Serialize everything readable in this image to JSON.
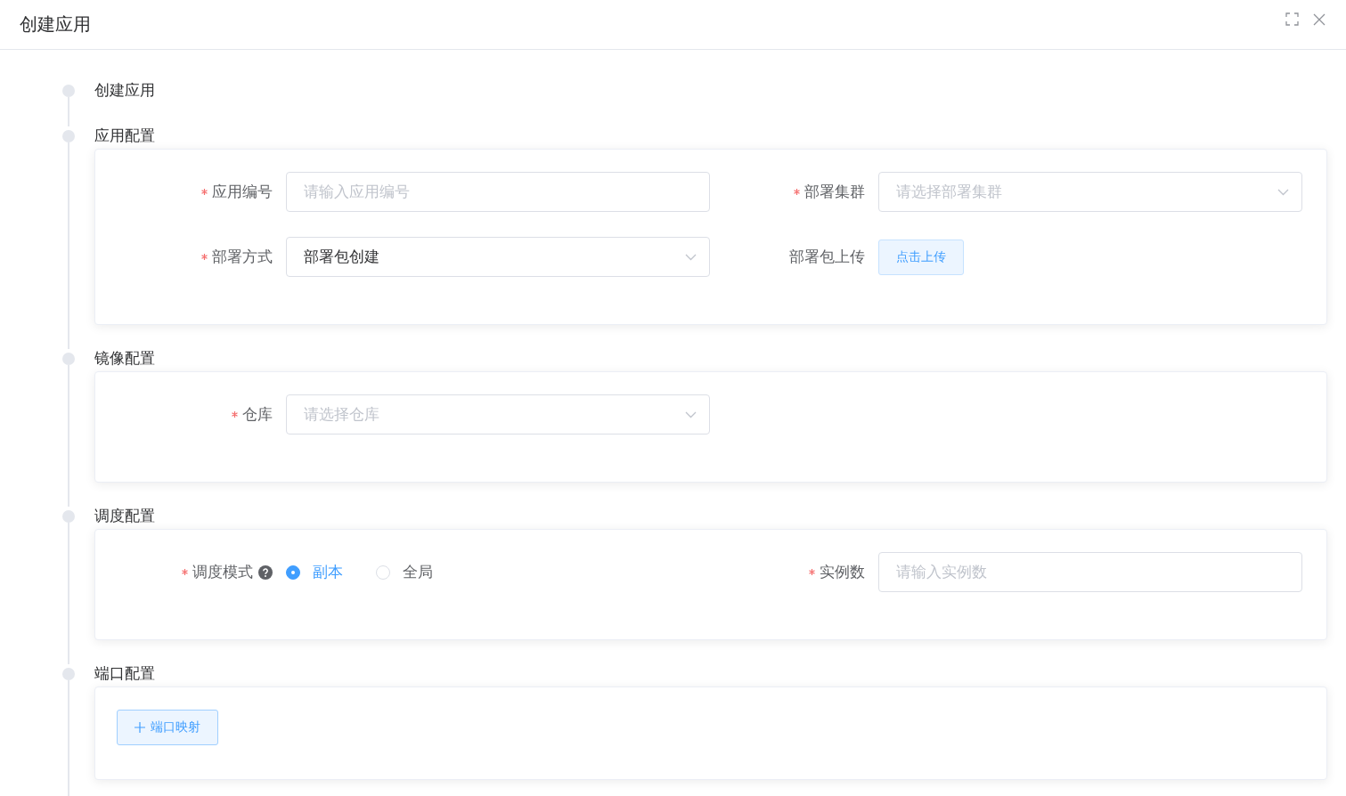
{
  "window": {
    "title": "创建应用"
  },
  "steps": [
    {
      "title": "创建应用"
    },
    {
      "title": "应用配置",
      "fields": [
        {
          "kind": "input",
          "label": "应用编号",
          "required": true,
          "placeholder": "请输入应用编号"
        },
        {
          "kind": "select",
          "label": "部署集群",
          "required": true,
          "placeholder": "请选择部署集群"
        },
        {
          "kind": "select",
          "label": "部署方式",
          "required": true,
          "value": "部署包创建"
        },
        {
          "kind": "upload",
          "label": "部署包上传",
          "required": false,
          "button": "点击上传"
        }
      ]
    },
    {
      "title": "镜像配置",
      "fields": [
        {
          "kind": "select",
          "label": "仓库",
          "required": true,
          "placeholder": "请选择仓库"
        }
      ]
    },
    {
      "title": "调度配置",
      "fields": [
        {
          "kind": "radio",
          "label": "调度模式",
          "required": true,
          "help": true,
          "options": [
            {
              "label": "副本",
              "selected": true
            },
            {
              "label": "全局",
              "selected": false
            }
          ]
        },
        {
          "kind": "input",
          "label": "实例数",
          "required": true,
          "placeholder": "请输入实例数"
        }
      ]
    },
    {
      "title": "端口配置",
      "fields": [
        {
          "kind": "add",
          "button": "端口映射"
        }
      ]
    }
  ]
}
